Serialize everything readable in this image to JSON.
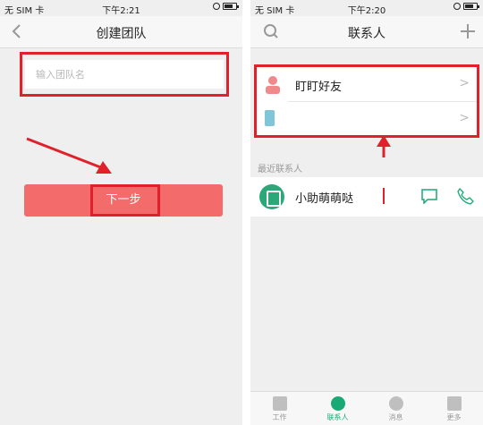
{
  "left": {
    "status": {
      "carrier": "无 SIM 卡",
      "time": "下午2:21"
    },
    "nav": {
      "title": "创建团队"
    },
    "team_input": {
      "placeholder": "输入团队名",
      "value": ""
    },
    "next_button": {
      "label": "下一步"
    }
  },
  "right": {
    "status": {
      "carrier": "无 SIM 卡",
      "time": "下午2:20"
    },
    "nav": {
      "title": "联系人",
      "search_icon": "search-icon",
      "add_icon": "plus-icon"
    },
    "contacts": [
      {
        "label": "盯盯好友",
        "icon": "person-icon"
      },
      {
        "label": "",
        "icon": "phone-contacts-icon"
      }
    ],
    "recent_section_title": "最近联系人",
    "recent": [
      {
        "name": "小助萌萌哒",
        "icon": "assistant-avatar-icon"
      }
    ],
    "tabs": [
      {
        "label": "工作",
        "icon": "work-icon"
      },
      {
        "label": "联系人",
        "icon": "contacts-icon",
        "active": true
      },
      {
        "label": "消息",
        "icon": "message-icon"
      },
      {
        "label": "更多",
        "icon": "more-grid-icon"
      }
    ]
  },
  "colors": {
    "highlight": "#e0212b",
    "button": "#f36b6b",
    "accent": "#19a974"
  }
}
